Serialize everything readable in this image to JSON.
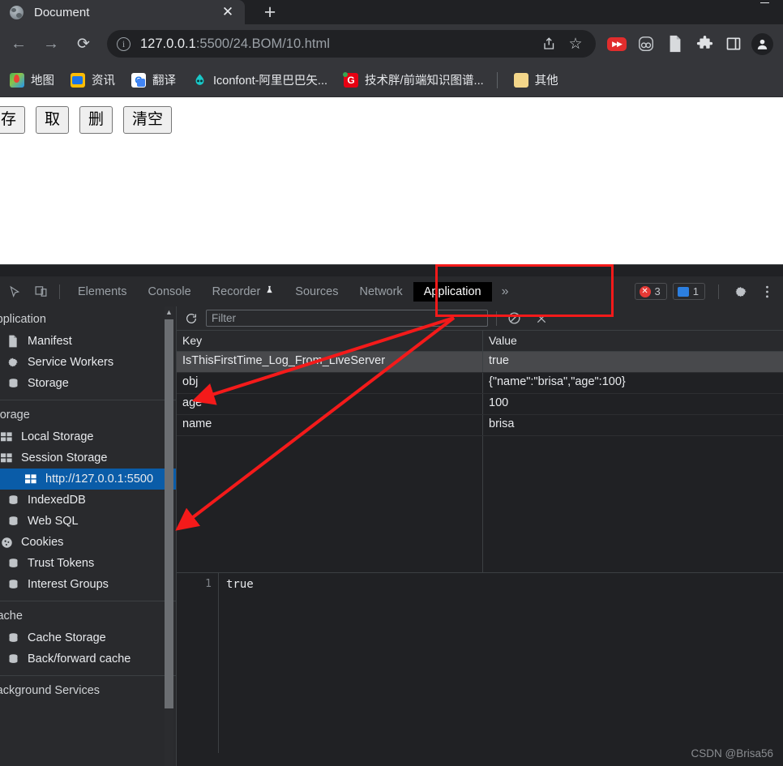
{
  "browser": {
    "tab": {
      "title": "Document",
      "favicon": "globe-icon",
      "close": "✕"
    },
    "new_tab": "+",
    "nav": {
      "back": "←",
      "forward": "→",
      "reload": "⟳"
    },
    "omnibox": {
      "info_icon": "i",
      "url_host": "127.0.0.1",
      "url_path": ":5500/24.BOM/10.html",
      "share_icon": "share-icon",
      "star_icon": "☆"
    },
    "extensions": [
      {
        "name": "video-speed-controller-icon",
        "glyph": "▶▶"
      },
      {
        "name": "pocket-icon",
        "glyph": "oo"
      },
      {
        "name": "document-extension-icon",
        "glyph": "὜b"
      },
      {
        "name": "extensions-puzzle-icon",
        "glyph": "❖"
      },
      {
        "name": "side-panel-icon",
        "glyph": "□"
      },
      {
        "name": "profile-avatar",
        "glyph": "●"
      }
    ],
    "bookmarks": [
      {
        "label": "地图",
        "icon": "maps-icon"
      },
      {
        "label": "资讯",
        "icon": "news-icon"
      },
      {
        "label": "翻译",
        "icon": "translate-icon"
      },
      {
        "label": "Iconfont-阿里巴巴矢...",
        "icon": "iconfont-icon"
      },
      {
        "label": "技术胖/前端知识图谱...",
        "icon": "jishupang-icon"
      }
    ],
    "bookmarks_other": {
      "label": "其他",
      "icon": "folder-icon"
    }
  },
  "page": {
    "buttons": [
      "存",
      "取",
      "删",
      "清空"
    ]
  },
  "devtools": {
    "inspect_icon": "inspect-arrow-icon",
    "device_icon": "device-toggle-icon",
    "tabs": [
      {
        "label": "Elements",
        "selected": false
      },
      {
        "label": "Console",
        "selected": false
      },
      {
        "label": "Recorder",
        "selected": false,
        "suffix_icon": "flask-icon"
      },
      {
        "label": "Sources",
        "selected": false
      },
      {
        "label": "Network",
        "selected": false
      },
      {
        "label": "Application",
        "selected": true
      }
    ],
    "more_tabs": "»",
    "errors_count": "3",
    "messages_count": "1",
    "settings_icon": "gear-icon",
    "menu_icon": "three-dots-icon",
    "sidebar": {
      "sections": [
        {
          "title": "Application",
          "items": [
            {
              "label": "Manifest",
              "icon": "manifest-page-icon",
              "arrow": false,
              "indent": 1,
              "selected": false
            },
            {
              "label": "Service Workers",
              "icon": "gear-icon",
              "arrow": false,
              "indent": 1,
              "selected": false
            },
            {
              "label": "Storage",
              "icon": "database-icon",
              "arrow": false,
              "indent": 1,
              "selected": false
            }
          ]
        },
        {
          "title": "Storage",
          "items": [
            {
              "label": "Local Storage",
              "icon": "table-icon",
              "arrow": "collapsed",
              "indent": 0,
              "selected": false
            },
            {
              "label": "Session Storage",
              "icon": "table-icon",
              "arrow": "expanded",
              "indent": 0,
              "selected": false
            },
            {
              "label": "http://127.0.0.1:5500",
              "icon": "table-icon",
              "arrow": false,
              "indent": 2,
              "selected": true
            },
            {
              "label": "IndexedDB",
              "icon": "database-icon",
              "arrow": false,
              "indent": 1,
              "selected": false
            },
            {
              "label": "Web SQL",
              "icon": "database-icon",
              "arrow": false,
              "indent": 1,
              "selected": false
            },
            {
              "label": "Cookies",
              "icon": "cookie-icon",
              "arrow": "collapsed",
              "indent": 0,
              "selected": false
            },
            {
              "label": "Trust Tokens",
              "icon": "database-icon",
              "arrow": false,
              "indent": 1,
              "selected": false
            },
            {
              "label": "Interest Groups",
              "icon": "database-icon",
              "arrow": false,
              "indent": 1,
              "selected": false
            }
          ]
        },
        {
          "title": "Cache",
          "items": [
            {
              "label": "Cache Storage",
              "icon": "database-icon",
              "arrow": false,
              "indent": 1,
              "selected": false
            },
            {
              "label": "Back/forward cache",
              "icon": "database-icon",
              "arrow": false,
              "indent": 1,
              "selected": false
            }
          ]
        },
        {
          "title": "Background Services",
          "items": []
        }
      ]
    },
    "filterbar": {
      "refresh_icon": "refresh-icon",
      "filter_placeholder": "Filter",
      "filter_value": "",
      "clear_all_icon": "clear-all-icon",
      "delete_icon": "delete-x-icon"
    },
    "storage_table": {
      "columns": [
        "Key",
        "Value"
      ],
      "rows": [
        {
          "key": "IsThisFirstTime_Log_From_LiveServer",
          "value": "true",
          "selected": true
        },
        {
          "key": "obj",
          "value": "{\"name\":\"brisa\",\"age\":100}",
          "selected": false
        },
        {
          "key": "age",
          "value": "100",
          "selected": false
        },
        {
          "key": "name",
          "value": "brisa",
          "selected": false
        }
      ]
    },
    "preview": {
      "line_number": "1",
      "content": "true"
    }
  },
  "watermark": "CSDN @Brisa56",
  "annotations": {
    "highlight_color": "#f41a1a",
    "rect_target": "Application",
    "arrows": [
      {
        "from": "application-tab",
        "to": "obj-row"
      },
      {
        "from": "application-tab",
        "to": "session-storage-origin-item"
      }
    ]
  }
}
